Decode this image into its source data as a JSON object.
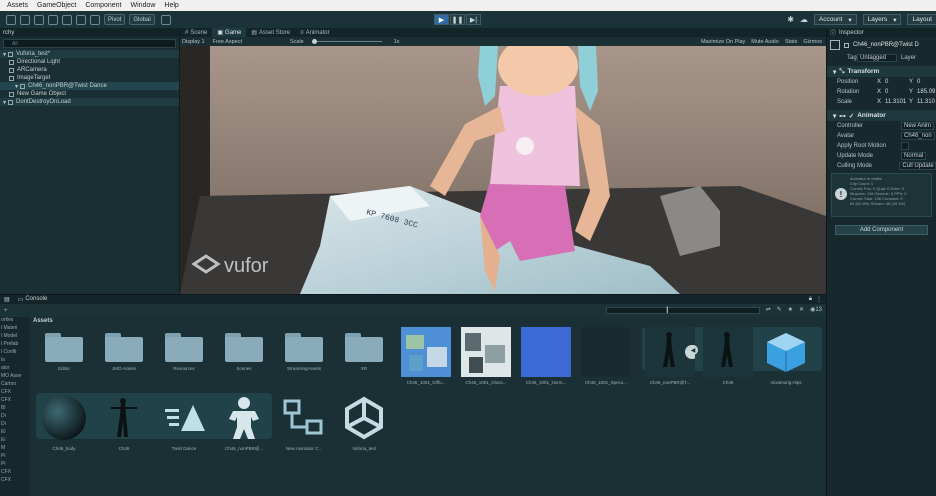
{
  "menu": [
    "Assets",
    "GameObject",
    "Component",
    "Window",
    "Help"
  ],
  "toolbar": {
    "pivot": "Pivot",
    "global": "Global",
    "account": "Account",
    "layers": "Layers",
    "layout": "Layout"
  },
  "hierarchy": {
    "tab": "rchy",
    "search_placeholder": "All",
    "items": [
      {
        "label": "Vuforia_test*",
        "indent": 0,
        "root": true
      },
      {
        "label": "Directional Light",
        "indent": 1
      },
      {
        "label": "ARCamera",
        "indent": 1
      },
      {
        "label": "ImageTarget",
        "indent": 1
      },
      {
        "label": "Ch46_nonPBR@Twist Dance",
        "indent": 2,
        "selected": true
      },
      {
        "label": "New Game Object",
        "indent": 1
      },
      {
        "label": "DontDestroyOnLoad",
        "indent": 0,
        "root": true
      }
    ]
  },
  "scene_tabs": [
    "Scene",
    "Game",
    "Asset Store",
    "Animator"
  ],
  "game_toolbar": {
    "display": "Display 1",
    "aspect": "Free Aspect",
    "scale_label": "Scale",
    "scale_value": "1x",
    "right": [
      "Maximize On Play",
      "Mute Audio",
      "Stats",
      "Gizmos"
    ]
  },
  "viewport": {
    "card_text": "KP 7608 3CC",
    "watermark": "vufor"
  },
  "inspector": {
    "tab": "Inspector",
    "object_name": "Ch46_nonPBR@Twist D",
    "tag_label": "Tag",
    "tag_value": "Untagged",
    "layer_label": "Layer",
    "transform": {
      "title": "Transform",
      "rows": [
        {
          "label": "Position",
          "x": "0",
          "y": "0"
        },
        {
          "label": "Rotation",
          "x": "0",
          "y": "185.09"
        },
        {
          "label": "Scale",
          "x": "11.3101",
          "y": "11.310"
        }
      ]
    },
    "animator": {
      "title": "Animator",
      "rows": [
        {
          "label": "Controller",
          "value": "New Anim"
        },
        {
          "label": "Avatar",
          "value": "Ch46_non"
        },
        {
          "label": "Apply Root Motion",
          "value": ""
        },
        {
          "label": "Update Mode",
          "value": "Normal"
        },
        {
          "label": "Culling Mode",
          "value": "Cull Update"
        }
      ]
    },
    "info_lines": [
      "Animator is visible",
      "Clip Count: 1",
      "Curves Pos: 0 Quat: 0 Euler: 0",
      "Muscles: 136 Generic: 0 PPtr: 0",
      "Curves Total: 136 Constant: 0",
      "84 (62.8%) Stream: 48 (35.3%)"
    ],
    "add_component": "Add Component"
  },
  "project": {
    "tabs": [
      "Console"
    ],
    "assets_label": "Assets",
    "count": "13",
    "left_tree": [
      "orites",
      "l Materi",
      "l Model",
      "l Prefab",
      "l Confli",
      "ts",
      "ator",
      "MO Asse",
      "Cartoo",
      "CFX",
      "CFX",
      "Bl",
      "Di",
      "Di",
      "El",
      "Ei",
      "M",
      "Pi",
      "Pi",
      "CFX",
      "CFX"
    ],
    "row1": [
      {
        "name": "Editor",
        "type": "folder"
      },
      {
        "name": "JMO Assets",
        "type": "folder"
      },
      {
        "name": "Resources",
        "type": "folder"
      },
      {
        "name": "Scenes",
        "type": "folder"
      },
      {
        "name": "StreamingAssets",
        "type": "folder"
      },
      {
        "name": "XR",
        "type": "folder"
      },
      {
        "name": "Ch46_1001_Diffu...",
        "type": "texture-a"
      },
      {
        "name": "Ch46_1001_Gloss...",
        "type": "texture-b"
      },
      {
        "name": "Ch46_1001_Norm...",
        "type": "texture-c"
      },
      {
        "name": "Ch46_1001_Specu...",
        "type": "texture-d"
      },
      {
        "name": "Ch46_nonPBR@T...",
        "type": "model"
      },
      {
        "name": "Ch46",
        "type": "model2"
      },
      {
        "name": "mixamorig:Hips",
        "type": "package"
      }
    ],
    "row2": [
      {
        "name": "Ch46_body",
        "type": "sphere"
      },
      {
        "name": "Ch46",
        "type": "figure"
      },
      {
        "name": "Twist Dance",
        "type": "anim"
      },
      {
        "name": "Ch46_nonPBR@...",
        "type": "avatar"
      },
      {
        "name": "New Animator C...",
        "type": "controller"
      },
      {
        "name": "Vuforia_test",
        "type": "unity"
      }
    ]
  }
}
